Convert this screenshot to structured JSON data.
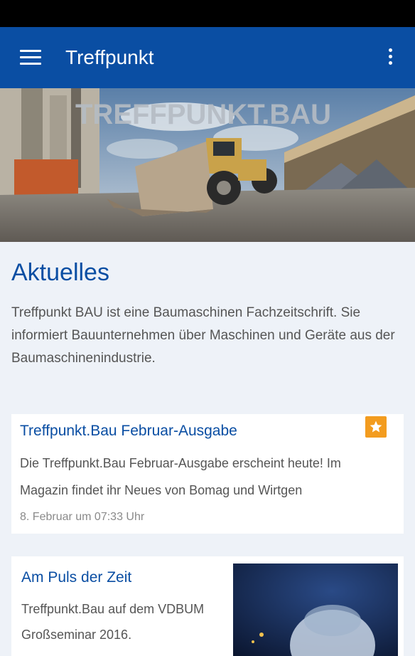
{
  "app_bar": {
    "title": "Treffpunkt",
    "menu_icon": "hamburger-menu-icon",
    "overflow_icon": "more-vert-icon",
    "color": "#0a4ea3"
  },
  "hero": {
    "logo_text": "TREFFPUNKT.BAU"
  },
  "section": {
    "title": "Aktuelles",
    "intro": "Treffpunkt BAU ist eine Baumaschinen Fachzeitschrift. Sie informiert Bauunternehmen über Maschinen und Geräte aus der Baumaschinenindustrie."
  },
  "posts": [
    {
      "title": "Treffpunkt.Bau Februar-Ausgabe",
      "body": "Die Treffpunkt.Bau Februar-Ausgabe erscheint heute! Im Magazin findet ihr Neues von Bomag und Wirtgen",
      "date": "8. Februar um 07:33 Uhr",
      "badge_icon": "star-icon",
      "badge_color": "#f39c1f"
    },
    {
      "title": "Am Puls der Zeit",
      "body": "Treffpunkt.Bau auf dem VDBUM Großseminar 2016."
    }
  ]
}
